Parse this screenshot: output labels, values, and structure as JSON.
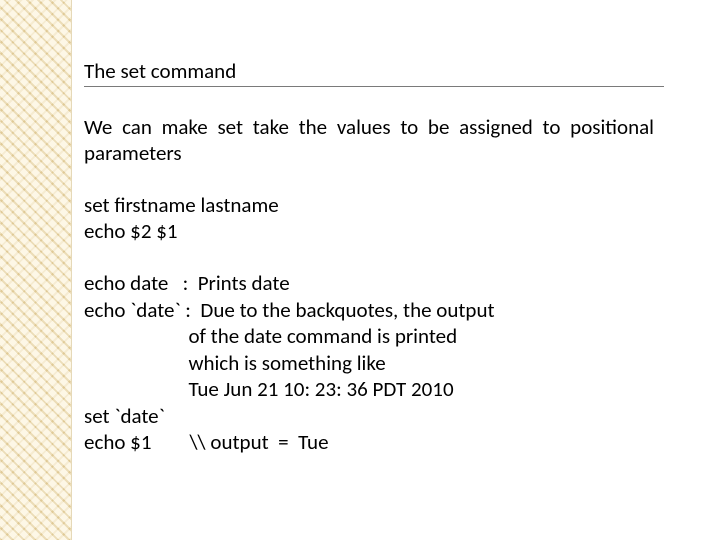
{
  "title": "The set command",
  "para1": "We can make set take the values to be assigned to positional parameters",
  "block1": "set firstname lastname\necho $2 $1",
  "block2": "echo date   :  Prints date\necho `date` :  Due to the backquotes, the output\n                      of the date command is printed\n                      which is something like\n                      Tue Jun 21 10: 23: 36 PDT 2010\nset `date`\necho $1        \\\\ output  =  Tue"
}
